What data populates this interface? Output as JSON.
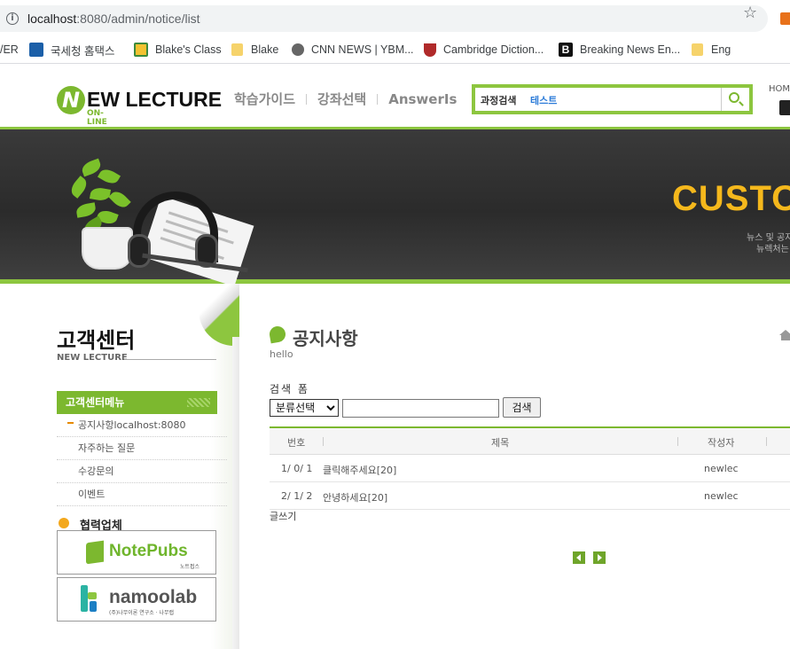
{
  "browser": {
    "url_host": "localhost",
    "url_port_path": ":8080/admin/notice/list"
  },
  "bookmarks": [
    {
      "label": "/ER",
      "icon": "none"
    },
    {
      "label": "국세청 홈택스",
      "icon": "hometax-icon"
    },
    {
      "label": "Blake's Class",
      "icon": "classroom-icon"
    },
    {
      "label": "Blake",
      "icon": "folder-icon"
    },
    {
      "label": "CNN NEWS | YBM...",
      "icon": "globe-icon"
    },
    {
      "label": "Cambridge Diction...",
      "icon": "cambridge-icon"
    },
    {
      "label": "Breaking News En...",
      "icon": "b-icon"
    },
    {
      "label": "Eng",
      "icon": "folder-icon"
    }
  ],
  "header": {
    "logo_main": "EW LECTURE",
    "logo_letter": "N",
    "logo_sub": "ON-LINE",
    "nav": [
      "학습가이드",
      "강좌선택",
      "AnswerIs"
    ],
    "search_label": "과정검색",
    "search_value": "테스트",
    "home_label": "HOM"
  },
  "banner": {
    "title": "CUSTO",
    "sub1": "뉴스 및 공지",
    "sub2": "뉴렉처는"
  },
  "sidebar": {
    "title": "고객센터",
    "subtitle": "NEW LECTURE",
    "menu_header": "고객센터메뉴",
    "items": [
      {
        "label": "공지사항localhost:8080",
        "active": true
      },
      {
        "label": "자주하는 질문",
        "active": false
      },
      {
        "label": "수강문의",
        "active": false
      },
      {
        "label": "이벤트",
        "active": false
      }
    ],
    "partners_title": "협력업체",
    "partners": [
      {
        "name": "NotePubs",
        "small": "노트펍스"
      },
      {
        "name": "namoolab",
        "small": "(주)나무이론 연구소 · 나무랩"
      }
    ]
  },
  "main": {
    "title": "공지사항",
    "subtitle": "hello",
    "search_form_label": "검색 폼",
    "category_selected": "분류선택",
    "query_value": "",
    "search_button": "검색",
    "columns": [
      "번호",
      "제목",
      "작성자"
    ],
    "rows": [
      {
        "no": "1/ 0/ 1",
        "title": "클릭해주세요[20]",
        "writer": "newlec"
      },
      {
        "no": "2/ 1/ 2",
        "title": "안녕하세요[20]",
        "writer": "newlec"
      }
    ],
    "write_link": "글쓰기"
  },
  "colors": {
    "accent_green": "#7cb82f",
    "banner_gold": "#f5b81c",
    "link_blue": "#2b7bd8"
  }
}
